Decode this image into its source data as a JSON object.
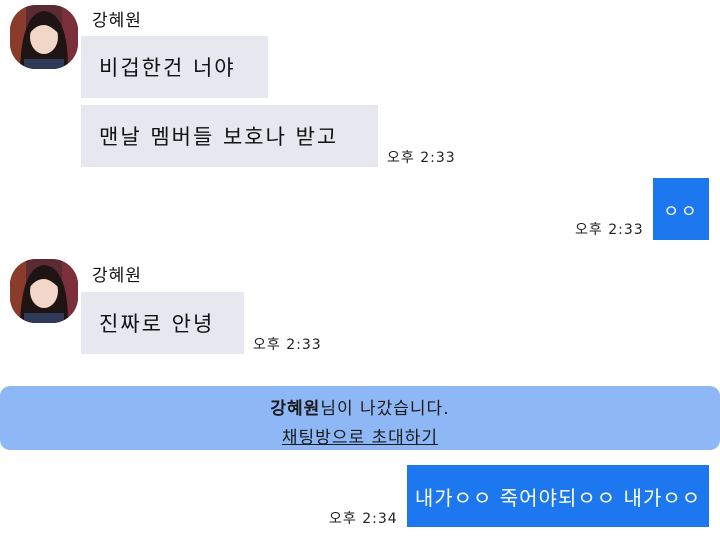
{
  "messages": [
    {
      "sender": "강혜원",
      "bubbles": [
        "비겁한건 너야",
        "맨날 멤버들 보호나 받고"
      ],
      "time": "오후 2:33"
    },
    {
      "mine": true,
      "bubbles": [
        "ㅇㅇ"
      ],
      "time": "오후 2:33"
    },
    {
      "sender": "강혜원",
      "bubbles": [
        "진짜로 안녕"
      ],
      "time": "오후 2:33"
    },
    {
      "mine": true,
      "bubbles": [
        "내가ㅇㅇ 죽어야되ㅇㅇ 내가ㅇㅇ"
      ],
      "time": "오후 2:34"
    }
  ],
  "system_notice": {
    "name": "강혜원",
    "text": "님이 나갔습니다.",
    "invite_link": "채팅방으로 초대하기"
  },
  "colors": {
    "incoming_bubble": "#e7e8ef",
    "outgoing_bubble": "#1d78f0",
    "notice_background": "#8db7f5"
  },
  "icons": {
    "avatar": "profile-photo-avatar"
  }
}
